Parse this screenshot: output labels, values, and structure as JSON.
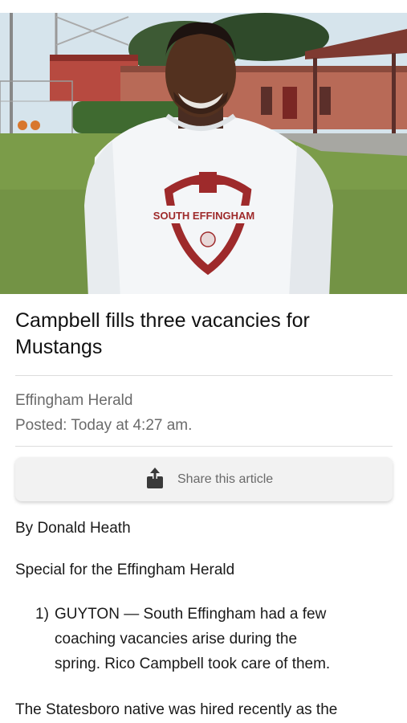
{
  "hero": {
    "image_name": "coach-portrait-photo",
    "shirt_text": "SOUTH EFFINGHAM"
  },
  "article": {
    "headline_line1": "Campbell fills three vacancies for",
    "headline_line2": "Mustangs",
    "source": "Effingham Herald",
    "posted": "Posted: Today at 4:27 am.",
    "share_label": "Share this article",
    "byline": "By Donald Heath",
    "special": "Special for the Effingham Herald",
    "list_number": "1)",
    "list_lines": [
      "GUYTON — South Effingham had a few",
      "coaching vacancies arise during the",
      "spring. Rico Campbell took care of them."
    ],
    "body_start": "The Statesboro native was hired recently as the"
  },
  "colors": {
    "accent": "#9e2a2b",
    "text": "#1a1a1a",
    "muted": "#6b6b6b",
    "share_bg": "#f2f2f2"
  },
  "icons": {
    "share": "share-icon"
  }
}
